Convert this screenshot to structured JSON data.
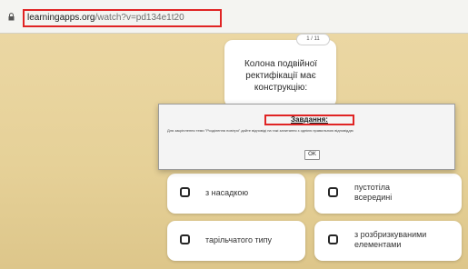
{
  "browser": {
    "url_host": "learningapps.org",
    "url_path": "/watch?v=pd134e1t20"
  },
  "quiz": {
    "counter": "1 / 11",
    "question": "Колона подвійної ректифікації має конструкцію:",
    "answers": [
      {
        "label": "з насадкою"
      },
      {
        "label": "пустотіла всередині"
      },
      {
        "label": "тарільчатого типу"
      },
      {
        "label": "з розбризкуваними елементами"
      }
    ]
  },
  "dialog": {
    "title": "Завдання:",
    "body": "Для закріплення теми \"Розділення повітря\" дайте відповіді на такі запитання з однією правильною відповіддю",
    "ok_label": "OK"
  },
  "colors": {
    "background": "#e3d09a",
    "highlight": "#e02424"
  }
}
